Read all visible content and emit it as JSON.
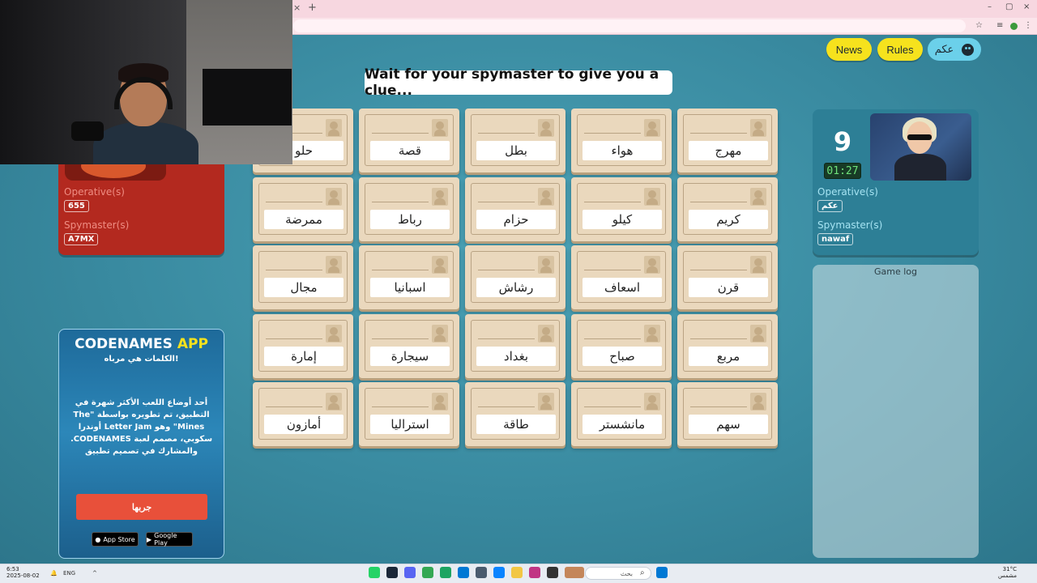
{
  "browser": {
    "tab_close": "×",
    "tab_new": "+",
    "controls": [
      "–",
      "▢",
      "×"
    ]
  },
  "header": {
    "news_label": "News",
    "rules_label": "Rules",
    "user_name": "عكم"
  },
  "banner": {
    "text": "Wait for your spymaster to give you a clue..."
  },
  "red_team": {
    "operatives_label": "Operative(s)",
    "operative_name": "655",
    "spymasters_label": "Spymaster(s)",
    "spymaster_name": "A7MX"
  },
  "blue_team": {
    "score": "9",
    "timer": "01:27",
    "operatives_label": "Operative(s)",
    "operative_name": "عكم",
    "spymasters_label": "Spymaster(s)",
    "spymaster_name": "nawaf"
  },
  "game_log": {
    "title": "Game log"
  },
  "ad": {
    "title_main": "CODENAMES",
    "title_accent": "APP",
    "subtitle": "الكلمات هي مرباه!",
    "body": "أحد أوضاع اللعب الأكثر شهرة في التطبيق، تم تطويره بواسطة \"The Mines\" وهو Letter Jam أوندرا سكوبي، مصمم لعبة CODENAMES. والمشارك في تصميم تطبيق",
    "cta": "جربها",
    "app_store": "App Store",
    "google_play": "Google Play"
  },
  "board": {
    "rows": [
      [
        "حلو",
        "قصة",
        "بطل",
        "هواء",
        "مهرج"
      ],
      [
        "ممرضة",
        "رباط",
        "حزام",
        "كيلو",
        "كريم"
      ],
      [
        "مجال",
        "اسبانيا",
        "رشاش",
        "اسعاف",
        "قرن"
      ],
      [
        "إمارة",
        "سيجارة",
        "بغداد",
        "صباح",
        "مربع"
      ],
      [
        "أمازون",
        "استراليا",
        "طاقة",
        "مانشستر",
        "سهم"
      ]
    ]
  },
  "taskbar": {
    "time": "6:53",
    "date": "2025-08-02",
    "lang": "ENG",
    "search_placeholder": "بحث",
    "weather_temp": "31°C",
    "weather_desc": "مشمس"
  },
  "colors": {
    "background": "#3b8da3",
    "red_team": "#b3291f",
    "blue_team": "#2d7f96",
    "yellow_button": "#f6e21d",
    "card": "#ead8bd"
  }
}
